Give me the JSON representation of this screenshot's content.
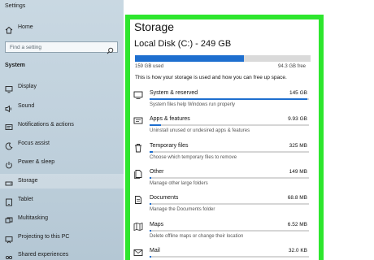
{
  "app": {
    "title": "Settings"
  },
  "sidebar": {
    "home_label": "Home",
    "search_placeholder": "Find a setting",
    "section_title": "System",
    "items": [
      {
        "label": "Display",
        "icon": "display-icon"
      },
      {
        "label": "Sound",
        "icon": "sound-icon"
      },
      {
        "label": "Notifications & actions",
        "icon": "notifications-icon"
      },
      {
        "label": "Focus assist",
        "icon": "focus-assist-icon"
      },
      {
        "label": "Power & sleep",
        "icon": "power-icon"
      },
      {
        "label": "Storage",
        "icon": "storage-icon",
        "selected": true
      },
      {
        "label": "Tablet",
        "icon": "tablet-icon"
      },
      {
        "label": "Multitasking",
        "icon": "multitasking-icon"
      },
      {
        "label": "Projecting to this PC",
        "icon": "projecting-icon"
      },
      {
        "label": "Shared experiences",
        "icon": "shared-experiences-icon"
      }
    ]
  },
  "storage": {
    "title": "Storage",
    "disk_title": "Local Disk (C:) - 249 GB",
    "used_label": "159 GB used",
    "free_label": "94.3 GB free",
    "used_fraction": 0.62,
    "description": "This is how your storage is used and how you can free up space.",
    "categories": [
      {
        "name": "System & reserved",
        "size": "145 GB",
        "sub": "System files help Windows run properly",
        "fraction": 0.99,
        "icon": "system-reserved-icon"
      },
      {
        "name": "Apps & features",
        "size": "9.93 GB",
        "sub": "Uninstall unused or undesired apps & features",
        "fraction": 0.07,
        "icon": "apps-features-icon"
      },
      {
        "name": "Temporary files",
        "size": "325 MB",
        "sub": "Choose which temporary files to remove",
        "fraction": 0.02,
        "icon": "trash-icon"
      },
      {
        "name": "Other",
        "size": "149 MB",
        "sub": "Manage other large folders",
        "fraction": 0.01,
        "icon": "other-files-icon"
      },
      {
        "name": "Documents",
        "size": "68.8 MB",
        "sub": "Manage the Documents folder",
        "fraction": 0.01,
        "icon": "documents-icon"
      },
      {
        "name": "Maps",
        "size": "6.52 MB",
        "sub": "Delete offline maps or change their location",
        "fraction": 0.005,
        "icon": "maps-icon"
      },
      {
        "name": "Mail",
        "size": "32.0 KB",
        "sub": "",
        "fraction": 0.002,
        "icon": "mail-icon"
      }
    ]
  },
  "colors": {
    "accent": "#1e6fcf",
    "highlight_frame": "#2ee62e",
    "sidebar_bg": "#c3d3de"
  }
}
